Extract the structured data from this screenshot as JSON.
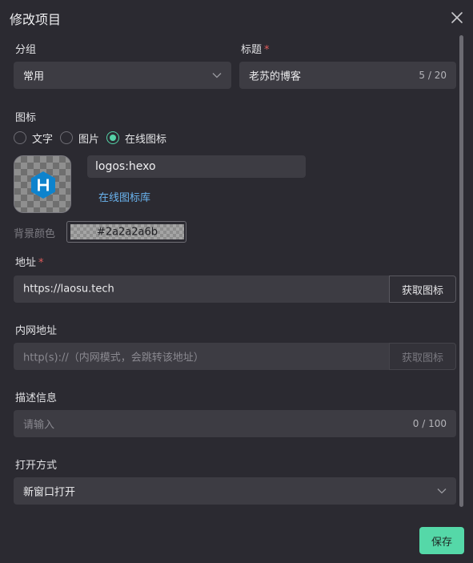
{
  "dialog": {
    "title": "修改项目"
  },
  "group": {
    "label": "分组",
    "value": "常用"
  },
  "name": {
    "label": "标题",
    "required_mark": "*",
    "value": "老苏的博客",
    "counter": "5 / 20"
  },
  "icon": {
    "label": "图标",
    "options": [
      "文字",
      "图片",
      "在线图标"
    ],
    "selected": "在线图标",
    "value": "logos:hexo",
    "library_link": "在线图标库",
    "preview_icon": "hexo-logo-icon"
  },
  "background": {
    "label": "背景颜色",
    "value": "#2a2a2a6b"
  },
  "address": {
    "label": "地址",
    "required_mark": "*",
    "value": "https://laosu.tech",
    "button": "获取图标"
  },
  "lan": {
    "label": "内网地址",
    "placeholder": "http(s)://（内网模式，会跳转该地址）",
    "button": "获取图标"
  },
  "description": {
    "label": "描述信息",
    "placeholder": "请输入",
    "counter": "0 / 100"
  },
  "open_mode": {
    "label": "打开方式",
    "value": "新窗口打开"
  },
  "footer": {
    "save_label": "保存"
  },
  "colors": {
    "accent": "#55d8a8",
    "link": "#6ab3ee",
    "required": "#e05b5b",
    "hexo_blue": "#0e83cd",
    "background": "#2b2a31",
    "field": "#3d3c43"
  }
}
